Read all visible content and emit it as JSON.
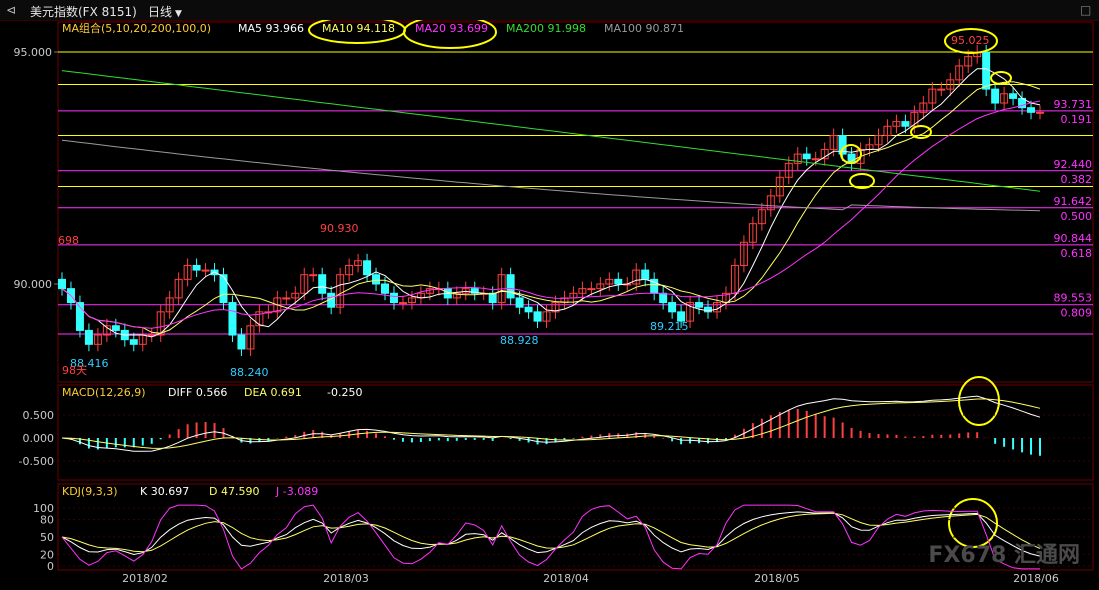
{
  "window": {
    "title": "美元指数(FX 8151)",
    "period": "日线"
  },
  "colors": {
    "up": "#ff4040",
    "down": "#33ffff",
    "ma5": "#ffffff",
    "ma10": "#ffff66",
    "ma20": "#ff33ff",
    "ma200": "#33dd33",
    "ma100": "#9a9a9a",
    "hline_yellow": "#ffff00",
    "hline_magenta": "#ff33ff",
    "axis_text": "#c8c8c8",
    "label_blue": "#33ccff"
  },
  "main_panel": {
    "indicator_label": "MA组合(5,10,20,200,100,0)",
    "ma_values": [
      {
        "label": "MA5 93.966",
        "color": "#ffffff"
      },
      {
        "label": "MA10 94.118",
        "color": "#ffff66"
      },
      {
        "label": "MA20 93.699",
        "color": "#ff33ff"
      },
      {
        "label": "MA200 91.998",
        "color": "#33dd33"
      },
      {
        "label": "MA100 90.871",
        "color": "#9a9a9a"
      }
    ],
    "y_ticks": [
      "95.000",
      "90.000"
    ],
    "price_labels": [
      "698",
      "88.416",
      "98天",
      "88.240",
      "90.930",
      "88.928",
      "89.215",
      "95.025"
    ],
    "level_labels": [
      "93.731",
      "0.191",
      "92.440",
      "0.382",
      "91.642",
      "0.500",
      "90.844",
      "0.618",
      "89.553",
      "0.809"
    ]
  },
  "macd_panel": {
    "label": "MACD(12,26,9)",
    "diff": "DIFF 0.566",
    "dea": "DEA 0.691",
    "macd": "-0.250",
    "y_ticks": [
      "0.500",
      "0.000",
      "-0.500"
    ]
  },
  "kdj_panel": {
    "label": "KDJ(9,3,3)",
    "k": "K 30.697",
    "d": "D 47.590",
    "j": "J -3.089",
    "y_ticks": [
      "100",
      "80",
      "50",
      "20",
      "0"
    ]
  },
  "x_axis": {
    "labels": [
      "2018/02",
      "2018/03",
      "2018/04",
      "2018/05",
      "2018/06"
    ]
  },
  "watermark": "FX678 汇通网",
  "chart_data": {
    "type": "candlestick",
    "title": "美元指数(FX 8151) 日线",
    "ylim": [
      88.0,
      95.5
    ],
    "x_labels": [
      "2018/02",
      "2018/03",
      "2018/04",
      "2018/05",
      "2018/06"
    ],
    "closes": [
      89.9,
      89.6,
      89.0,
      88.7,
      88.9,
      89.1,
      89.0,
      88.8,
      88.7,
      88.9,
      88.9,
      89.4,
      89.7,
      90.1,
      90.4,
      90.3,
      90.3,
      90.2,
      89.6,
      88.9,
      88.6,
      89.1,
      89.4,
      89.4,
      89.7,
      89.7,
      89.8,
      90.2,
      90.2,
      89.8,
      89.5,
      90.2,
      90.4,
      90.5,
      90.2,
      90.0,
      89.8,
      89.6,
      89.6,
      89.7,
      89.8,
      89.9,
      89.9,
      89.7,
      89.8,
      89.9,
      89.8,
      89.8,
      89.6,
      90.2,
      89.7,
      89.5,
      89.4,
      89.2,
      89.4,
      89.6,
      89.7,
      89.8,
      89.9,
      89.9,
      90.0,
      90.1,
      90.0,
      90.0,
      90.3,
      90.1,
      89.8,
      89.6,
      89.4,
      89.2,
      89.6,
      89.5,
      89.4,
      89.6,
      89.8,
      90.4,
      90.9,
      91.3,
      91.6,
      91.9,
      92.3,
      92.6,
      92.8,
      92.7,
      92.7,
      92.9,
      93.2,
      92.8,
      92.6,
      92.9,
      93.0,
      93.2,
      93.4,
      93.5,
      93.4,
      93.7,
      93.9,
      94.2,
      94.2,
      94.4,
      94.7,
      94.9,
      95.0,
      94.2,
      93.9,
      94.1,
      94.0,
      93.8,
      93.7,
      93.7
    ],
    "price_labels": [
      {
        "text": "698",
        "value": 90.98
      },
      {
        "text": "88.416",
        "value": 88.416
      },
      {
        "text": "88.240",
        "value": 88.24
      },
      {
        "text": "90.930",
        "value": 90.93
      },
      {
        "text": "88.928",
        "value": 88.928
      },
      {
        "text": "89.215",
        "value": 89.215
      },
      {
        "text": "95.025",
        "value": 95.025
      }
    ],
    "fib_levels": [
      {
        "price": 93.731,
        "ratio": "0.191"
      },
      {
        "price": 92.44,
        "ratio": "0.382"
      },
      {
        "price": 91.642,
        "ratio": "0.500"
      },
      {
        "price": 90.844,
        "ratio": "0.618"
      },
      {
        "price": 89.553,
        "ratio": "0.809"
      }
    ],
    "ma_latest": {
      "MA5": 93.966,
      "MA10": 94.118,
      "MA20": 93.699,
      "MA200": 91.998,
      "MA100": 90.871
    },
    "macd": {
      "DIFF": 0.566,
      "DEA": 0.691,
      "MACD": -0.25
    },
    "kdj": {
      "K": 30.697,
      "D": 47.59,
      "J": -3.089
    }
  }
}
